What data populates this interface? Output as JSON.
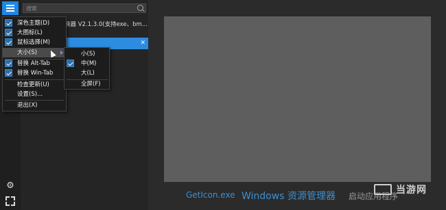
{
  "search": {
    "placeholder": "搜索"
  },
  "list": {
    "item_text": "换器 V2.1.3.0(支持exe、bm..."
  },
  "main_menu": {
    "items": [
      {
        "label": "深色主题(D)",
        "checked": true
      },
      {
        "label": "大图标(L)",
        "checked": true
      },
      {
        "label": "鼠标选择(M)",
        "checked": true
      },
      {
        "label": "大小(S)",
        "checked": false,
        "has_submenu": true
      },
      {
        "label": "替换 Alt-Tab",
        "checked": true
      },
      {
        "label": "替换 Win-Tab",
        "checked": true
      },
      {
        "label": "检查更新(U)",
        "checked": false
      },
      {
        "label": "设置(S)...",
        "checked": false
      },
      {
        "label": "退出(X)",
        "checked": false
      }
    ]
  },
  "size_submenu": {
    "items": [
      {
        "label": "小(S)",
        "checked": false
      },
      {
        "label": "中(M)",
        "checked": true
      },
      {
        "label": "大(L)",
        "checked": false
      },
      {
        "label": "全屏(F)",
        "checked": false
      }
    ]
  },
  "footer_labels": {
    "getIcon": "GetIcon.exe",
    "explorer": "Windows 资源管理器",
    "startup": "启动应用程序"
  },
  "watermark": {
    "text": "当游网"
  },
  "icons": {
    "menu": "hamburger-icon",
    "search": "search-icon",
    "settings": "gear-icon",
    "fullscreen": "expand-icon",
    "close": "close-icon",
    "submenu_arrow": "chevron-right-icon",
    "cursor": "mouse-cursor-icon"
  },
  "colors": {
    "accent": "#2d8ce0",
    "background": "#2b2b2b",
    "preview": "#5e5e5e",
    "link": "#3d8fd1"
  }
}
